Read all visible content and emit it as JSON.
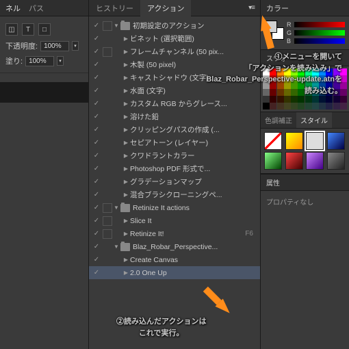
{
  "left": {
    "tab1": "ネル",
    "tab2": "パス",
    "opacity_label": "下透明度:",
    "opacity_value": "100%",
    "fill_label": "塗り:",
    "fill_value": "100%"
  },
  "mid": {
    "tab_history": "ヒストリー",
    "tab_actions": "アクション",
    "items": [
      {
        "chk": true,
        "box": true,
        "exp": "▼",
        "folder": true,
        "name": "初期設定のアクション",
        "ind": 0
      },
      {
        "chk": true,
        "box": false,
        "exp": "▶",
        "folder": false,
        "name": "ビネット (選択範囲)",
        "ind": 1
      },
      {
        "chk": true,
        "box": true,
        "exp": "▶",
        "folder": false,
        "name": "フレームチャンネル (50 pix...",
        "ind": 1
      },
      {
        "chk": true,
        "box": false,
        "exp": "▶",
        "folder": false,
        "name": "木製 (50 pixel)",
        "ind": 1
      },
      {
        "chk": true,
        "box": false,
        "exp": "▶",
        "folder": false,
        "name": "キャストシャドウ (文字)",
        "ind": 1
      },
      {
        "chk": true,
        "box": false,
        "exp": "▶",
        "folder": false,
        "name": "水面 (文字)",
        "ind": 1
      },
      {
        "chk": true,
        "box": false,
        "exp": "▶",
        "folder": false,
        "name": "カスタム RGB からグレース...",
        "ind": 1
      },
      {
        "chk": true,
        "box": false,
        "exp": "▶",
        "folder": false,
        "name": "溶けた鉛",
        "ind": 1
      },
      {
        "chk": true,
        "box": false,
        "exp": "▶",
        "folder": false,
        "name": "クリッピングパスの作成 (...",
        "ind": 1
      },
      {
        "chk": true,
        "box": false,
        "exp": "▶",
        "folder": false,
        "name": "セピアトーン (レイヤー)",
        "ind": 1
      },
      {
        "chk": true,
        "box": false,
        "exp": "▶",
        "folder": false,
        "name": "クワドラントカラー",
        "ind": 1
      },
      {
        "chk": true,
        "box": false,
        "exp": "▶",
        "folder": false,
        "name": "Photoshop PDF 形式で...",
        "ind": 1
      },
      {
        "chk": true,
        "box": false,
        "exp": "▶",
        "folder": false,
        "name": "グラデーションマップ",
        "ind": 1
      },
      {
        "chk": true,
        "box": false,
        "exp": "▶",
        "folder": false,
        "name": "混合ブラシクローニングペ...",
        "ind": 1
      },
      {
        "chk": true,
        "box": true,
        "exp": "▼",
        "folder": true,
        "name": "Retinize It actions",
        "ind": 0
      },
      {
        "chk": true,
        "box": true,
        "exp": "▶",
        "folder": false,
        "name": "Slice It",
        "ind": 1
      },
      {
        "chk": true,
        "box": true,
        "exp": "▶",
        "folder": false,
        "name": "Retinize It!",
        "ind": 1,
        "sc": "F6"
      },
      {
        "chk": true,
        "box": false,
        "exp": "▼",
        "folder": true,
        "name": "Blaz_Robar_Perspective...",
        "ind": 0
      },
      {
        "chk": true,
        "box": false,
        "exp": "▶",
        "folder": false,
        "name": "Create Canvas",
        "ind": 1
      },
      {
        "chk": true,
        "box": false,
        "exp": "▶",
        "folder": false,
        "name": "2.0 One Up",
        "ind": 1,
        "sel": true
      }
    ]
  },
  "right": {
    "tab_color": "カラー",
    "swatch_label": "スウォ",
    "tab_adjust": "色調補正",
    "tab_style": "スタイル",
    "prop_label": "属性",
    "prop_none": "プロパティなし"
  },
  "swatches": [
    "#ffffff",
    "#ff0000",
    "#ff8800",
    "#ffff00",
    "#88ff00",
    "#00ff00",
    "#00ff88",
    "#00ffff",
    "#0088ff",
    "#0000ff",
    "#8800ff",
    "#ff00ff",
    "#cccccc",
    "#cc0000",
    "#cc6600",
    "#cccc00",
    "#66cc00",
    "#00cc00",
    "#00cc66",
    "#00cccc",
    "#0066cc",
    "#0000cc",
    "#6600cc",
    "#cc00cc",
    "#999999",
    "#990000",
    "#994400",
    "#999900",
    "#449900",
    "#009900",
    "#009944",
    "#009999",
    "#004499",
    "#000099",
    "#440099",
    "#990099",
    "#666666",
    "#660000",
    "#663300",
    "#666600",
    "#336600",
    "#006600",
    "#006633",
    "#006666",
    "#003366",
    "#000066",
    "#330066",
    "#660066",
    "#333333",
    "#330000",
    "#331100",
    "#333300",
    "#113300",
    "#003300",
    "#003311",
    "#003333",
    "#001133",
    "#000033",
    "#110033",
    "#330033",
    "#000000",
    "#442222",
    "#443322",
    "#444422",
    "#334422",
    "#224422",
    "#224433",
    "#224444",
    "#223344",
    "#222244",
    "#332244",
    "#442244"
  ],
  "styles": [
    {
      "bg": "#fff",
      "diag": true
    },
    {
      "bg": "linear-gradient(135deg,#ff0,#f80)"
    },
    {
      "bg": "#ddd",
      "sel": true
    },
    {
      "bg": "linear-gradient(135deg,#48f,#004)"
    },
    {
      "bg": "linear-gradient(135deg,#8f8,#040)"
    },
    {
      "bg": "linear-gradient(135deg,#f44,#400)"
    },
    {
      "bg": "linear-gradient(135deg,#c8f,#408)"
    },
    {
      "bg": "linear-gradient(135deg,#888,#222)"
    }
  ],
  "annot": {
    "a1_l1": "①メニューを開いて",
    "a1_l2": "「アクションを読み込み」で",
    "a1_l3": "Blaz_Robar_Perspective-update.atnを",
    "a1_l4": "読み込む。",
    "a2_l1": "②読み込んだアクションは",
    "a2_l2": "これで実行。"
  }
}
